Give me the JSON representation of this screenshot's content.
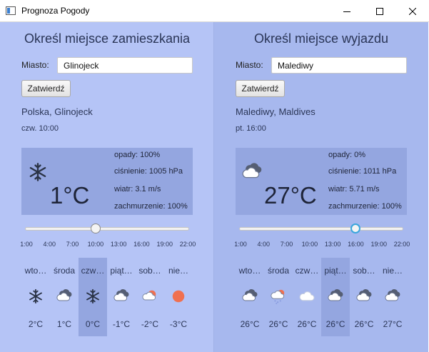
{
  "window": {
    "title": "Prognoza Pogody"
  },
  "colors": {
    "sun": "#f07050",
    "cloud": "#ffffff",
    "cloud_dark": "#555e73",
    "snow": "#2a3346",
    "rain": "#8a9de0",
    "focus": "#3aa6dc"
  },
  "slider_ticks": [
    "1:00",
    "4:00",
    "7:00",
    "10:00",
    "13:00",
    "16:00",
    "19:00",
    "22:00"
  ],
  "left": {
    "heading": "Określ miejsce zamieszkania",
    "city_label": "Miasto:",
    "city_value": "Glinojeck",
    "submit_label": "Zatwierdź",
    "location": "Polska, Glinojeck",
    "datetime": "czw. 10:00",
    "current": {
      "icon": "snowflake-icon",
      "temp": "1°C",
      "precip": "opady: 100%",
      "pressure": "ciśnienie: 1005 hPa",
      "wind": "wiatr: 3.1 m/s",
      "clouds": "zachmurzenie: 100%"
    },
    "slider_value": 0.43,
    "days": [
      {
        "name": "wto…",
        "icon": "snowflake-icon",
        "temp": "2°C",
        "selected": false
      },
      {
        "name": "środa",
        "icon": "cloud-icon",
        "temp": "1°C",
        "selected": false
      },
      {
        "name": "czw…",
        "icon": "snowflake-icon",
        "temp": "0°C",
        "selected": true
      },
      {
        "name": "piąt…",
        "icon": "cloud-icon",
        "temp": "-1°C",
        "selected": false
      },
      {
        "name": "sob…",
        "icon": "sun-cloud-icon",
        "temp": "-2°C",
        "selected": false
      },
      {
        "name": "nie…",
        "icon": "sun-icon",
        "temp": "-3°C",
        "selected": false
      }
    ]
  },
  "right": {
    "heading": "Określ miejsce wyjazdu",
    "city_label": "Miasto:",
    "city_value": "Malediwy",
    "submit_label": "Zatwierdź",
    "location": "Malediwy, Maldives",
    "datetime": "pt. 16:00",
    "current": {
      "icon": "cloud-icon",
      "temp": "27°C",
      "precip": "opady: 0%",
      "pressure": "ciśnienie: 1011 hPa",
      "wind": "wiatr: 5.71 m/s",
      "clouds": "zachmurzenie: 100%"
    },
    "slider_value": 0.71,
    "days": [
      {
        "name": "wto…",
        "icon": "cloud-icon",
        "temp": "26°C",
        "selected": false
      },
      {
        "name": "środa",
        "icon": "sun-rain-cloud-icon",
        "temp": "26°C",
        "selected": false
      },
      {
        "name": "czw…",
        "icon": "white-cloud-icon",
        "temp": "26°C",
        "selected": false
      },
      {
        "name": "piąt…",
        "icon": "cloud-icon",
        "temp": "26°C",
        "selected": true
      },
      {
        "name": "sob…",
        "icon": "cloud-icon",
        "temp": "26°C",
        "selected": false
      },
      {
        "name": "nie…",
        "icon": "cloud-icon",
        "temp": "27°C",
        "selected": false
      }
    ]
  }
}
